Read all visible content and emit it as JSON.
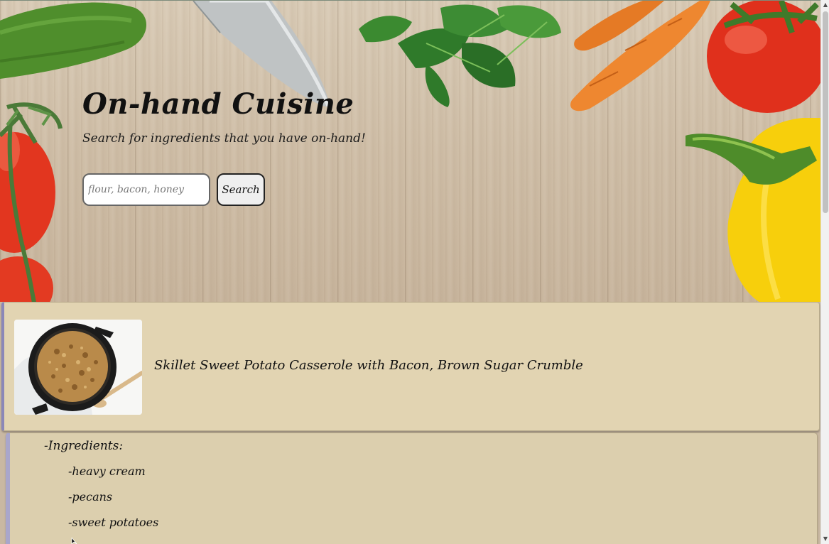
{
  "hero": {
    "title": "On-hand Cuisine",
    "subtitle": "Search for ingredients that you have on-hand!",
    "search": {
      "placeholder": "flour, bacon, honey",
      "value": "",
      "button_label": "Search"
    }
  },
  "results": [
    {
      "title": "Skillet Sweet Potato Casserole with Bacon, Brown Sugar Crumble",
      "ingredients_heading": "-Ingredients:",
      "ingredients": [
        "-heavy cream",
        "-pecans",
        "-sweet potatoes"
      ]
    }
  ],
  "colors": {
    "card_background": "#e2d4b2",
    "panel_background": "#dccfae",
    "card_accent": "#8b87b8",
    "panel_accent": "#a9a6cb"
  },
  "icons": {
    "scroll_up": "scroll-up-arrow-icon",
    "scroll_down": "scroll-down-arrow-icon",
    "cursor": "mouse-pointer-icon"
  }
}
